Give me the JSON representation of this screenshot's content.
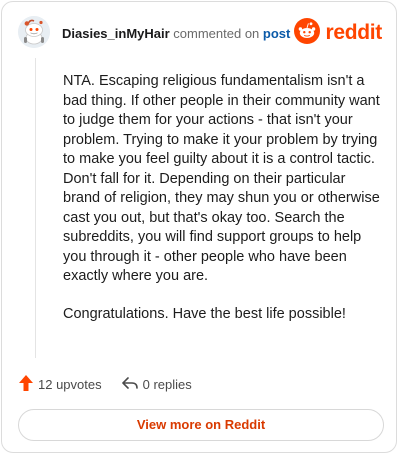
{
  "header": {
    "username": "Diasies_inMyHair",
    "action_text": "commented on",
    "post_link": "post",
    "brand": "reddit"
  },
  "comment": {
    "paragraphs": [
      "NTA. Escaping religious fundamentalism isn't a bad thing. If other people in their community want to judge them for your actions - that isn't your problem. Trying to make it your problem by trying to make you feel guilty about it is a control tactic. Don't fall for it. Depending on their particular brand of religion, they may shun you or otherwise cast you out, but that's okay too. Search the subreddits, you will find support groups to help you through it - other people who have been exactly where you are.",
      "Congratulations. Have the best life possible!"
    ]
  },
  "actions": {
    "upvotes": "12 upvotes",
    "replies": "0 replies"
  },
  "footer": {
    "view_button": "View more on Reddit"
  },
  "colors": {
    "brand_orange": "#ff4500",
    "link_blue": "#0b5aa8",
    "button_text": "#d93a00"
  },
  "icons": {
    "avatar": "snoo-avatar-icon",
    "brand": "reddit-logo-icon",
    "upvote": "upvote-arrow-icon",
    "reply": "reply-arrow-icon"
  }
}
